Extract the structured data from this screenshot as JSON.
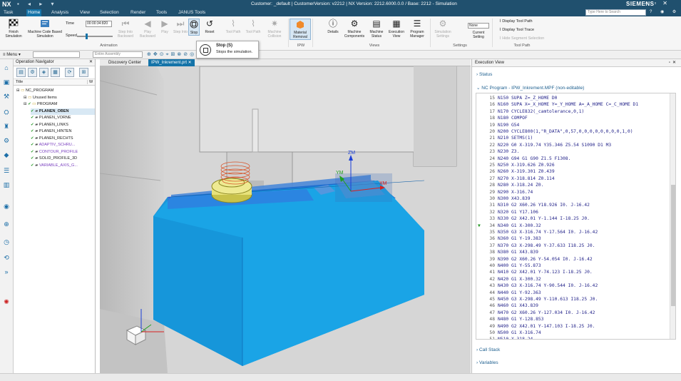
{
  "title_bar": {
    "app_logo": "NX",
    "window_title": "Customer: _default | CustomerVersion: v2212 | NX Version: 2212.6000.0.0 / Base: 2212 - Simulation",
    "brand": "SIEMENS"
  },
  "menu_tabs": [
    "Task",
    "Home",
    "Analysis",
    "View",
    "Selection",
    "Render",
    "Tools",
    "JANUS Tools"
  ],
  "active_tab": "Home",
  "search": {
    "placeholder": "Type Here to Search"
  },
  "ribbon": {
    "finish_simulation": "Finish Simulation",
    "machine_code_sim": "Machine Code Based Simulation",
    "time_label": "Time",
    "time_value": "00:00:34:820",
    "speed_label": "Speed",
    "step_into_backward": "Step Into Backward",
    "play_backward": "Play Backward",
    "play": "Play",
    "step_into": "Step Into",
    "stop": "Stop",
    "reset": "Reset",
    "tool_path": "Tool Path",
    "tool_path2": "Tool Path",
    "machine_collision": "Machine Collision",
    "material_removal": "Material Removal",
    "details": "Details",
    "machine_components": "Machine Components",
    "machine_status": "Machine Status",
    "execution_view": "Execution View",
    "program_manager": "Program Manager",
    "simulation_settings": "Simulation Settings",
    "none_value": "None",
    "current_setting": "Current Setting",
    "display_tool_path": "Display Tool Path",
    "display_tool_trace": "Display Tool Trace",
    "hide_segment_selection": "Hide Segment Selection",
    "groups": {
      "animation": "Animation",
      "ipw": "IPW",
      "views": "Views",
      "settings": "Settings",
      "tool_path": "Tool Path"
    }
  },
  "tooltip": {
    "title": "Stop (S)",
    "description": "Stops the simulation."
  },
  "toolbar2": {
    "menu": "Menu",
    "filter_placeholder": "Entire Assembly"
  },
  "operation_navigator": {
    "title": "Operation Navigator",
    "column_title": "Title",
    "column_w": "W",
    "items": [
      {
        "label": "NC_PROGRAM",
        "indent": 0,
        "purple": false,
        "checked": false,
        "selected": false
      },
      {
        "label": "Unused Items",
        "indent": 1,
        "purple": false,
        "checked": false,
        "selected": false
      },
      {
        "label": "PROGRAM",
        "indent": 1,
        "purple": false,
        "checked": true,
        "selected": false
      },
      {
        "label": "PLANEN_OBEN",
        "indent": 2,
        "purple": false,
        "checked": true,
        "selected": true
      },
      {
        "label": "PLANEN_VORNE",
        "indent": 2,
        "purple": false,
        "checked": true,
        "selected": false
      },
      {
        "label": "PLANEN_LINKS",
        "indent": 2,
        "purple": false,
        "checked": true,
        "selected": false
      },
      {
        "label": "PLANEN_HINTEN",
        "indent": 2,
        "purple": false,
        "checked": true,
        "selected": false
      },
      {
        "label": "PLANEN_RECHTS",
        "indent": 2,
        "purple": false,
        "checked": true,
        "selected": false
      },
      {
        "label": "ADAPTIV_SCHRU...",
        "indent": 2,
        "purple": true,
        "checked": true,
        "selected": false
      },
      {
        "label": "CONTOUR_PROFILE",
        "indent": 2,
        "purple": true,
        "checked": true,
        "selected": false
      },
      {
        "label": "SOLID_PROFILE_3D",
        "indent": 2,
        "purple": false,
        "checked": true,
        "selected": false
      },
      {
        "label": "VARIABLE_AXIS_G...",
        "indent": 2,
        "purple": true,
        "checked": true,
        "selected": false
      }
    ]
  },
  "doc_tabs": [
    {
      "label": "Discovery Center",
      "active": false
    },
    {
      "label": "IPW_Inkrement.prt",
      "active": true
    }
  ],
  "viewport": {
    "axis_zm": "ZM",
    "axis_ym": "YM",
    "axis_xm": "XM"
  },
  "execution_view": {
    "title": "Execution View",
    "status_label": "Status",
    "program_label": "NC Program - IPW_Inkrement.MPF (non-editable)",
    "call_stack_label": "Call Stack",
    "variables_label": "Variables",
    "current_line": 34,
    "lines": [
      {
        "n": "15",
        "code": "N150 SUPA Z=_Z_HOME D0"
      },
      {
        "n": "16",
        "code": "N160 SUPA X=_X_HOME Y=_Y_HOME A=_A_HOME C=_C_HOME D1"
      },
      {
        "n": "17",
        "code": "N170 CYCLE832(_camtolerance,0,1)"
      },
      {
        "n": "18",
        "code": "N180 COMPOF"
      },
      {
        "n": "19",
        "code": "N190 G54"
      },
      {
        "n": "20",
        "code": "N200 CYCLE800(1,\"R_DATA\",0,57,0,0,0,0,0,0,0,0,1,0)"
      },
      {
        "n": "21",
        "code": "N210 SETMS(1)"
      },
      {
        "n": "22",
        "code": "N220 G0 X-319.74 Y35.346 Z5.54 S1090 D1 M3"
      },
      {
        "n": "23",
        "code": "N230 Z3."
      },
      {
        "n": "24",
        "code": "N240 G94 G1 G90 Z1.5 F1308."
      },
      {
        "n": "25",
        "code": "N250 X-319.626 Z0.926"
      },
      {
        "n": "26",
        "code": "N260 X-319.301 Z0.439"
      },
      {
        "n": "27",
        "code": "N270 X-318.814 Z0.114"
      },
      {
        "n": "28",
        "code": "N280 X-318.24 Z0."
      },
      {
        "n": "29",
        "code": "N290 X-316.74"
      },
      {
        "n": "30",
        "code": "N300 X43.839"
      },
      {
        "n": "31",
        "code": "N310 G2 X60.26 Y18.926 I0. J-16.42"
      },
      {
        "n": "32",
        "code": "N320 G1 Y17.106"
      },
      {
        "n": "33",
        "code": "N330 G2 X42.01 Y-1.144 I-18.25 J0."
      },
      {
        "n": "34",
        "code": "N340 G1 X-300.32"
      },
      {
        "n": "35",
        "code": "N350 G3 X-316.74 Y-17.564 I0. J-16.42"
      },
      {
        "n": "36",
        "code": "N360 G1 Y-19.383"
      },
      {
        "n": "37",
        "code": "N370 G3 X-298.49 Y-37.633 I18.25 J0."
      },
      {
        "n": "38",
        "code": "N380 G1 X43.839"
      },
      {
        "n": "39",
        "code": "N390 G2 X60.26 Y-54.054 I0. J-16.42"
      },
      {
        "n": "40",
        "code": "N400 G1 Y-55.873"
      },
      {
        "n": "41",
        "code": "N410 G2 X42.01 Y-74.123 I-18.25 J0."
      },
      {
        "n": "42",
        "code": "N420 G1 X-300.32"
      },
      {
        "n": "43",
        "code": "N430 G3 X-316.74 Y-90.544 I0. J-16.42"
      },
      {
        "n": "44",
        "code": "N440 G1 Y-92.363"
      },
      {
        "n": "45",
        "code": "N450 G3 X-298.49 Y-110.613 I18.25 J0."
      },
      {
        "n": "46",
        "code": "N460 G1 X43.839"
      },
      {
        "n": "47",
        "code": "N470 G2 X60.26 Y-127.034 I0. J-16.42"
      },
      {
        "n": "48",
        "code": "N480 G1 Y-128.853"
      },
      {
        "n": "49",
        "code": "N490 G2 X42.01 Y-147.103 I-18.25 J0."
      },
      {
        "n": "50",
        "code": "N500 G1 X-316.74"
      },
      {
        "n": "51",
        "code": "N510 X-318.24"
      }
    ]
  },
  "colors": {
    "title_bar": "#20506e",
    "tab_active": "#1473a8",
    "workpiece": "#1aa4e6",
    "tool": "#e8e27a",
    "nc_code": "#24248a",
    "check": "#2a9a2a"
  }
}
